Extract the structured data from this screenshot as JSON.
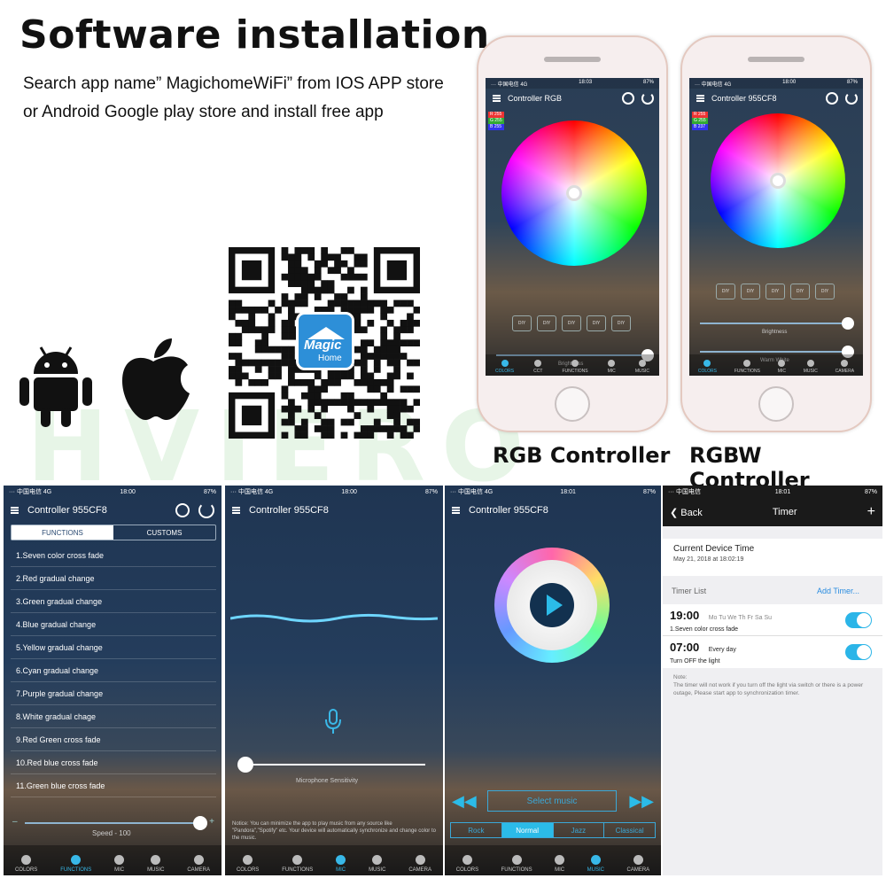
{
  "header": {
    "title": "Software installation",
    "line1": "Search app name” MagichomeWiFi” from IOS APP store",
    "line2": "or Android Google play store and install free app"
  },
  "watermark": "HVIERO",
  "qr": {
    "logo_top": "Magic",
    "logo_bottom": "Home"
  },
  "phone_rgb": {
    "caption": "RGB Controller",
    "status_left": "··· 中国电信 4G",
    "status_time": "18:03",
    "status_right": "87%",
    "title": "Controller RGB",
    "rgb_values": [
      "R 255",
      "G 255",
      "B 255"
    ],
    "diy": [
      "DIY",
      "DIY",
      "DIY",
      "DIY",
      "DIY"
    ],
    "slider_label": "Brightness",
    "slider_level": 1.0,
    "tabs": [
      "COLORS",
      "CCT",
      "FUNCTIONS",
      "MIC",
      "MUSIC"
    ]
  },
  "phone_rgbw": {
    "caption": "RGBW Controller",
    "status_left": "··· 中国电信 4G",
    "status_time": "18:00",
    "status_right": "87%",
    "title": "Controller 955CF8",
    "rgb_values": [
      "R 255",
      "G 255",
      "B 237"
    ],
    "diy": [
      "DIY",
      "DIY",
      "DIY",
      "DIY",
      "DIY"
    ],
    "slider1_label": "Brightness",
    "slider2_label": "Warm White",
    "tabs": [
      "COLORS",
      "FUNCTIONS",
      "MIC",
      "MUSIC",
      "CAMERA"
    ]
  },
  "screen_functions": {
    "status_left": "··· 中国电信 4G",
    "status_time": "18:00",
    "status_right": "87%",
    "title": "Controller 955CF8",
    "seg": [
      "FUNCTIONS",
      "CUSTOMS"
    ],
    "items": [
      "1.Seven color cross fade",
      "2.Red gradual change",
      "3.Green gradual change",
      "4.Blue gradual change",
      "5.Yellow gradual change",
      "6.Cyan gradual change",
      "7.Purple gradual change",
      "8.White gradual chage",
      "9.Red Green cross fade",
      "10.Red blue cross fade",
      "11.Green blue cross fade"
    ],
    "minus": "–",
    "plus": "+",
    "speed_label": "Speed - 100",
    "speed_level": 1.0,
    "tabs": [
      "COLORS",
      "FUNCTIONS",
      "MIC",
      "MUSIC",
      "CAMERA"
    ]
  },
  "screen_mic": {
    "status_left": "··· 中国电信 4G",
    "status_time": "18:00",
    "status_right": "87%",
    "title": "Controller 955CF8",
    "slider_label": "Microphone Sensitivity",
    "slider_level": 0.0,
    "notice": "Notice: You can minimize the app to play music from any source like \"Pandora\",\"Spotify\" etc. Your device will automatically synchronize and change color to the music.",
    "tabs": [
      "COLORS",
      "FUNCTIONS",
      "MIC",
      "MUSIC",
      "CAMERA"
    ]
  },
  "screen_music": {
    "status_left": "··· 中国电信 4G",
    "status_time": "18:01",
    "status_right": "87%",
    "title": "Controller 955CF8",
    "select_music": "Select music",
    "prev": "◀◀",
    "next": "▶▶",
    "genres": [
      "Rock",
      "Normal",
      "Jazz",
      "Classical"
    ],
    "selected_genre": "Normal",
    "tabs": [
      "COLORS",
      "FUNCTIONS",
      "MIC",
      "MUSIC",
      "CAMERA"
    ]
  },
  "screen_timer": {
    "status_left": "··· 中国电信",
    "status_time": "18:01",
    "status_right": "87%",
    "back": "Back",
    "title": "Timer",
    "add_icon": "+",
    "current_time_label": "Current Device Time",
    "current_time_value": "May 21, 2018 at 18:02:19",
    "timer_list_label": "Timer List",
    "add_timer": "Add Timer...",
    "timers": [
      {
        "time": "19:00",
        "days": "Mo Tu We Th Fr Sa Su",
        "action": "1.Seven color cross fade",
        "enabled": true
      },
      {
        "time": "07:00",
        "days": "Every day",
        "action": "Turn OFF the light",
        "enabled": true
      }
    ],
    "note": "Note:\nThe timer will not work if you turn off the light via switch or there is a power outage, Please start app to synchronization timer."
  }
}
